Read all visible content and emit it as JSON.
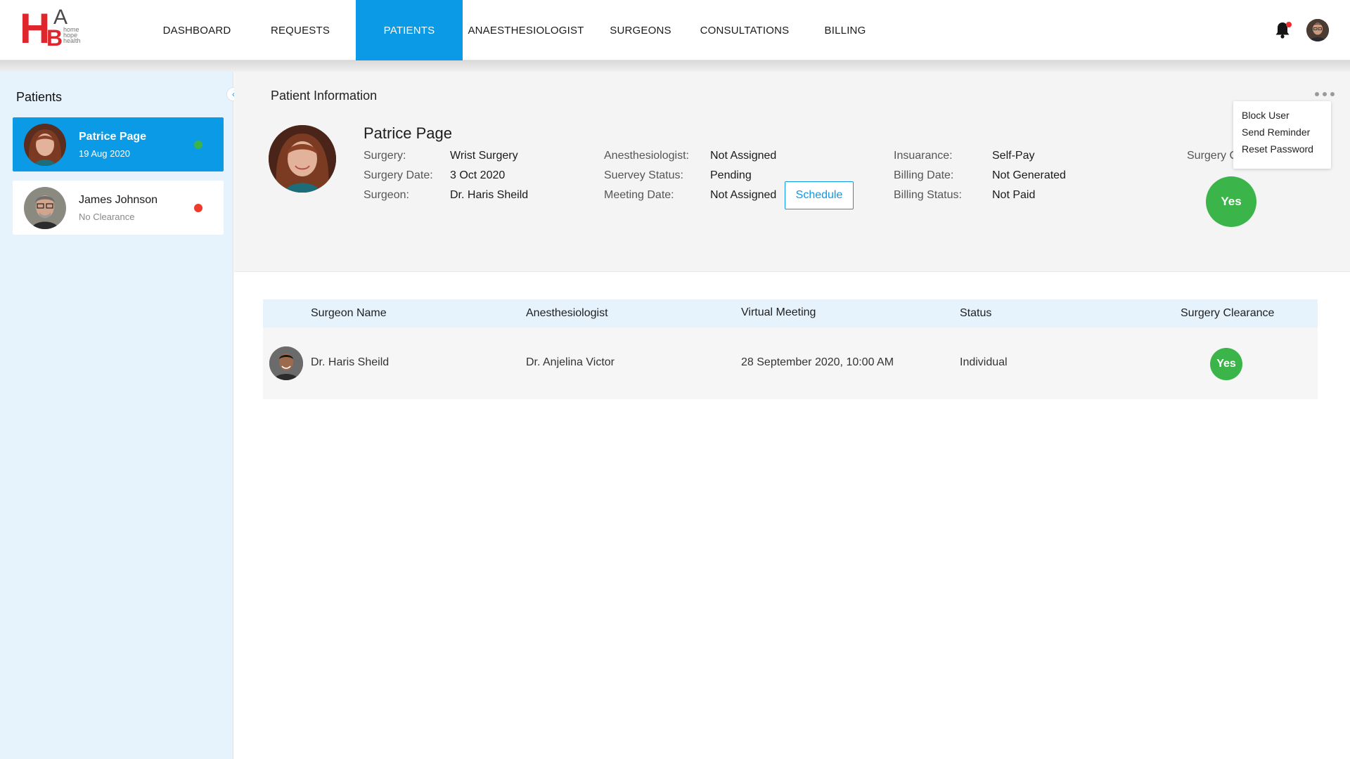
{
  "app": {
    "logo": {
      "letters": "HAB",
      "tagline": "home hope health anesthesia"
    }
  },
  "nav": {
    "items": [
      {
        "label": "DASHBOARD"
      },
      {
        "label": "REQUESTS"
      },
      {
        "label": "PATIENTS",
        "active": true
      },
      {
        "label": "ANAESTHESIOLOGIST"
      },
      {
        "label": "SURGEONS"
      },
      {
        "label": "CONSULTATIONS"
      },
      {
        "label": "BILLING"
      }
    ],
    "notification_icon": "bell-icon",
    "has_unread_notification": true
  },
  "sidebar": {
    "title": "Patients",
    "collapse_icon": "chevron-left-icon",
    "patients": [
      {
        "name": "Patrice Page",
        "subtitle": "19 Aug 2020",
        "status_color": "#3bb54a",
        "selected": true
      },
      {
        "name": "James Johnson",
        "subtitle": "No Clearance",
        "status_color": "#ee3b2b",
        "selected": false
      }
    ]
  },
  "patient_info": {
    "section_title": "Patient Information",
    "name": "Patrice Page",
    "col1": [
      {
        "label": "Surgery:",
        "value": "Wrist Surgery"
      },
      {
        "label": "Surgery Date:",
        "value": "3 Oct 2020"
      },
      {
        "label": "Surgeon:",
        "value": "Dr. Haris Sheild"
      }
    ],
    "col2": [
      {
        "label": "Anesthesiologist:",
        "value": "Not Assigned"
      },
      {
        "label": "Suervey Status:",
        "value": "Pending"
      },
      {
        "label": "Meeting Date:",
        "value": "Not Assigned"
      }
    ],
    "col3": [
      {
        "label": "Insuarance:",
        "value": "Self-Pay"
      },
      {
        "label": "Billing Date:",
        "value": "Not Generated"
      },
      {
        "label": "Billing Status:",
        "value": "Not Paid"
      }
    ],
    "schedule_button": "Schedule",
    "clearance_label": "Surgery C",
    "clearance_value": "Yes",
    "more_icon": "more-horizontal-icon",
    "menu": [
      "Block User",
      "Send Reminder",
      "Reset Password"
    ]
  },
  "table": {
    "headers": [
      "Surgeon Name",
      "Anesthesiologist",
      "Virtual Meeting",
      "Status",
      "Surgery Clearance"
    ],
    "rows": [
      {
        "surgeon": "Dr. Haris Sheild",
        "anesthesiologist": "Dr. Anjelina Victor",
        "meeting": "28 September 2020, 10:00 AM",
        "status": "Individual",
        "clearance": "Yes"
      }
    ]
  },
  "colors": {
    "accent": "#0a9ae6",
    "sidebar_bg": "#e6f3fc",
    "success": "#3bb54a",
    "danger": "#ee3b2b",
    "brand_red": "#e0262d"
  }
}
